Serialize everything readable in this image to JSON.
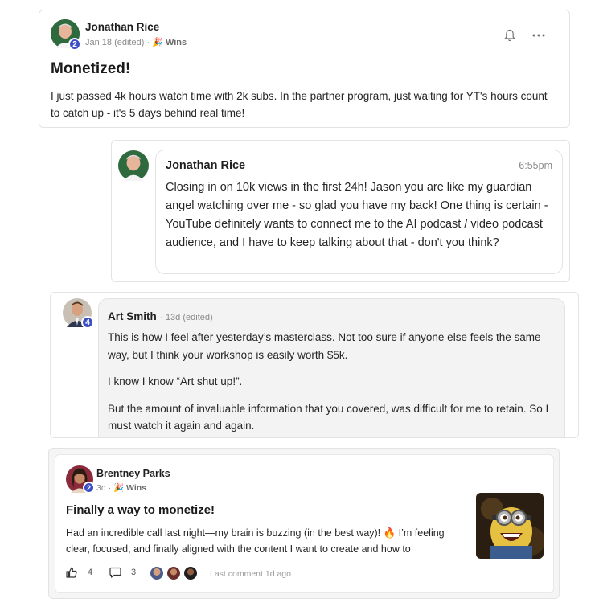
{
  "post1": {
    "author": "Jonathan Rice",
    "badge": "2",
    "date": "Jan 18 (edited)",
    "category_emoji": "🎉",
    "category": "Wins",
    "title": "Monetized!",
    "body": "I just passed 4k hours watch time with 2k subs. In the partner program, just waiting for YT's hours count to catch up - it's 5 days behind real time!"
  },
  "comment1": {
    "author": "Jonathan Rice",
    "time": "6:55pm",
    "body": "Closing in on 10k views in the first 24h! Jason you are like my guardian angel watching over me - so glad you have my back! One thing is certain - YouTube definitely wants to connect me to the AI podcast / video podcast audience, and I have to keep talking about that - don't you think?"
  },
  "comment2": {
    "author": "Art Smith",
    "badge": "4",
    "meta": "13d (edited)",
    "paragraphs": [
      "This is how I feel after yesterday’s masterclass. Not too sure if anyone else feels the same way, but I think your workshop is easily worth $5k.",
      "I know I know “Art shut up!”.",
      "But the amount of invaluable information that you covered, was difficult for me to retain. So I must watch it again and again."
    ]
  },
  "post2": {
    "author": "Brentney Parks",
    "badge": "2",
    "date": "3d",
    "category_emoji": "🎉",
    "category": "Wins",
    "title": "Finally a way to monetize!",
    "body": "Had an incredible call last night—my brain is buzzing (in the best way)! 🔥 I’m feeling clear, focused, and finally aligned with the content I want to create and how to",
    "likes": "4",
    "comments": "3",
    "last_comment": "Last comment 1d ago"
  },
  "icons": {
    "bell": "bell-icon",
    "more": "more-horizontal-icon",
    "like": "thumbs-up-icon",
    "comment": "comment-icon"
  },
  "colors": {
    "badge": "#3d4fc4"
  }
}
